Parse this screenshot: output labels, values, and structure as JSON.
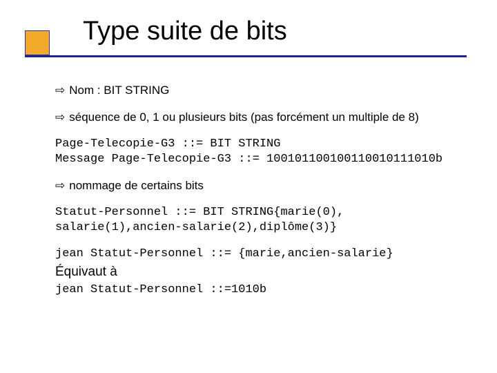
{
  "title": "Type suite de bits",
  "bullets": {
    "b1": "Nom : BIT STRING",
    "b2": "séquence de 0, 1 ou plusieurs bits (pas forcément un multiple de 8)",
    "b3": "nommage de certains bits"
  },
  "code": {
    "c1": "Page-Telecopie-G3 ::= BIT STRING\nMessage Page-Telecopie-G3 ::= 100101100100110010111010b",
    "c2": "Statut-Personnel ::= BIT STRING{marie(0),\nsalarie(1),ancien-salarie(2),diplôme(3)}",
    "c3": "jean Statut-Personnel ::= {marie,ancien-salarie}",
    "c4": "jean Statut-Personnel ::=1010b"
  },
  "plain": {
    "equiv": "Équivaut à"
  },
  "glyph": {
    "arrow": "⇨"
  }
}
